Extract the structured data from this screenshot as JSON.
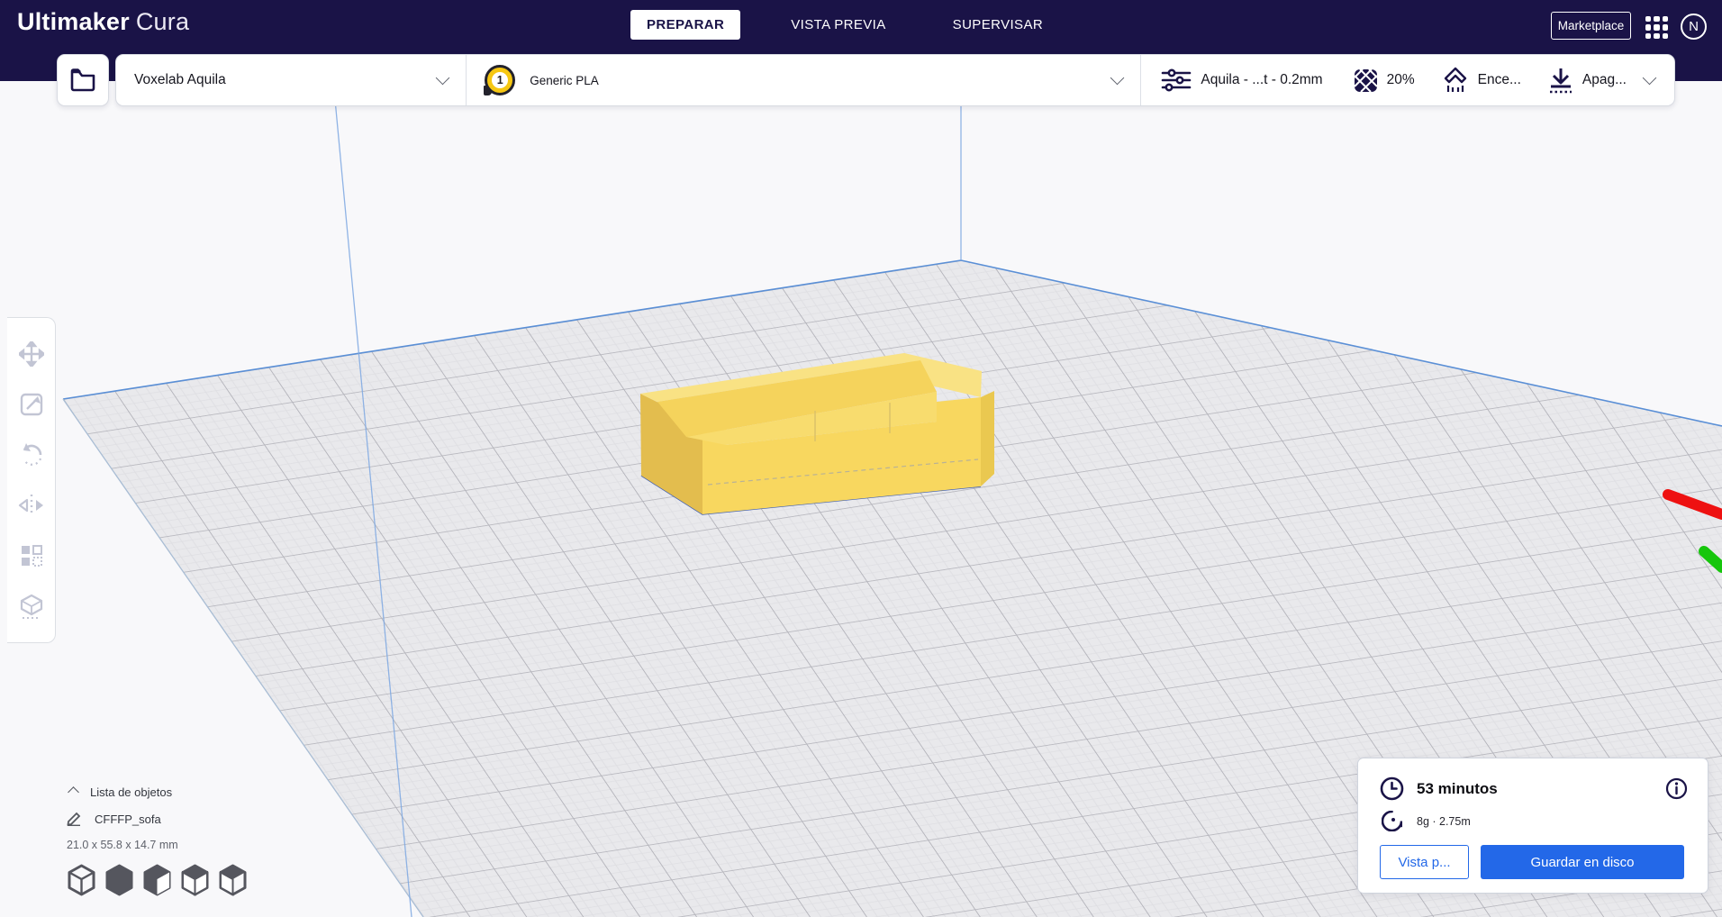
{
  "header": {
    "logo_bold": "Ultimaker",
    "logo_light": "Cura",
    "tabs": [
      {
        "label": "PREPARAR",
        "active": true
      },
      {
        "label": "VISTA PREVIA",
        "active": false
      },
      {
        "label": "SUPERVISAR",
        "active": false
      }
    ],
    "marketplace_label": "Marketplace",
    "avatar_initial": "N"
  },
  "toolbar": {
    "machine_name": "Voxelab Aquila",
    "extruder_number": "1",
    "material_name": "Generic PLA",
    "profile_summary": "Aquila - ...t - 0.2mm",
    "infill_value": "20%",
    "support_value": "Ence...",
    "adhesion_value": "Apag..."
  },
  "object_list": {
    "title": "Lista de objetos",
    "item_name": "CFFFP_sofa",
    "dimensions": "21.0 x 55.8 x 14.7 mm"
  },
  "summary": {
    "print_time": "53 minutos",
    "material_usage": "8g · 2.75m",
    "preview_button": "Vista p...",
    "save_button": "Guardar en disco"
  },
  "icons": {
    "top": [
      "folder-icon",
      "grid-apps-icon",
      "avatar-circle"
    ],
    "settings": [
      "sliders-icon",
      "infill-icon",
      "support-icon",
      "adhesion-icon"
    ],
    "tools": [
      "move-icon",
      "scale-icon",
      "rotate-icon",
      "mirror-icon",
      "per-model-settings-icon",
      "support-blocker-icon"
    ],
    "summary": [
      "clock-icon",
      "info-icon",
      "spool-icon"
    ],
    "view_presets": [
      "view-3d",
      "view-front",
      "view-top",
      "view-left",
      "view-right"
    ]
  },
  "colors": {
    "header_navy": "#1a1347",
    "accent_blue": "#2368e8",
    "material_yellow": "#f6c712",
    "model_yellow": "#f8d75f",
    "axis_x_red": "#ee1111",
    "axis_y_green": "#16c60c",
    "plate_gray": "#e9e9ec"
  }
}
